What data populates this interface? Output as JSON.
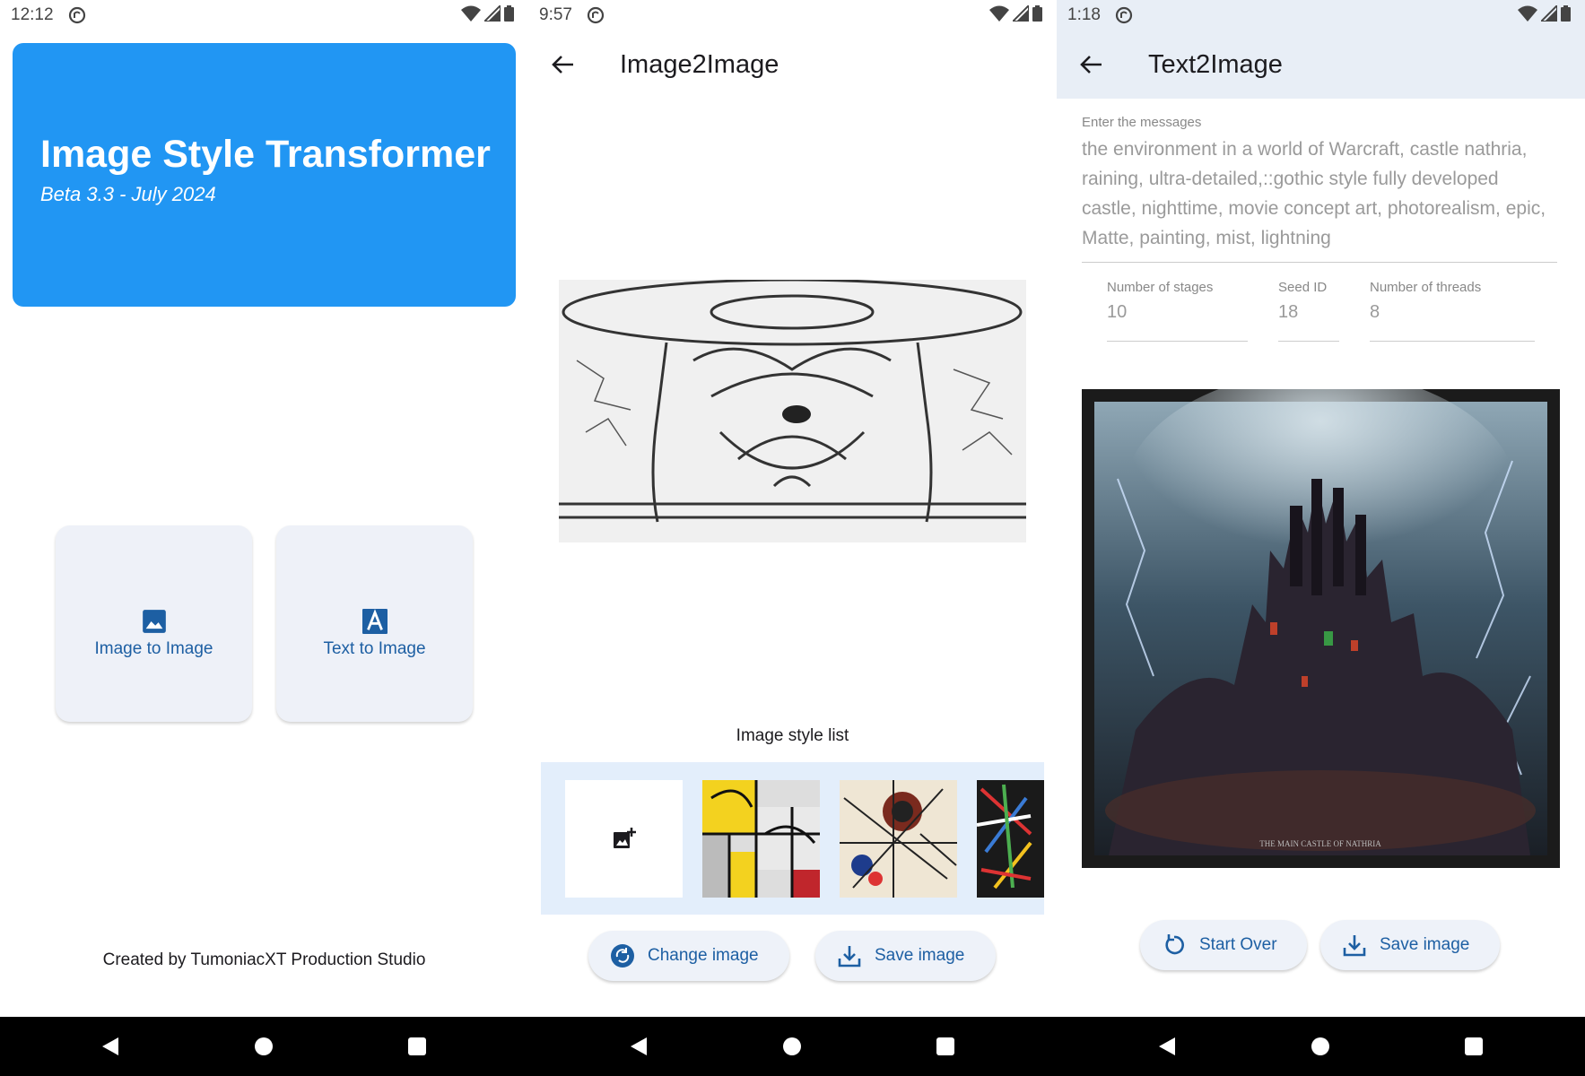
{
  "screen1": {
    "status_time": "12:12",
    "hero_title": "Image Style Transformer",
    "hero_subtitle": "Beta 3.3 - July 2024",
    "card_image_to_image": "Image to Image",
    "card_text_to_image": "Text to Image",
    "credit": "Created by TumoniacXT Production Studio",
    "colors": {
      "hero": "#2196f3",
      "accent": "#1d5fa3"
    },
    "icons": [
      "image-icon",
      "text-a-icon"
    ]
  },
  "screen2": {
    "status_time": "9:57",
    "title": "Image2Image",
    "style_list_label": "Image style list",
    "change_image_label": "Change image",
    "save_image_label": "Save image",
    "icons": [
      "back-arrow-icon",
      "add-photo-icon",
      "sync-icon",
      "download-icon"
    ]
  },
  "screen3": {
    "status_time": "1:18",
    "title": "Text2Image",
    "messages_label": "Enter the messages",
    "messages_text": "the environment in a world of Warcraft, castle nathria, raining, ultra-detailed,::gothic style fully developed castle, nighttime, movie concept art, photorealism, epic, Matte, painting, mist, lightning",
    "stages_label": "Number of stages",
    "stages_value": "10",
    "seed_label": "Seed ID",
    "seed_value": "18",
    "threads_label": "Number of threads",
    "threads_value": "8",
    "image_caption": "THE MAIN CASTLE OF NATHRIA",
    "start_over_label": "Start Over",
    "save_image_label": "Save image",
    "icons": [
      "back-arrow-icon",
      "restart-icon",
      "download-icon"
    ]
  },
  "navigation": {
    "icons": [
      "back-triangle-icon",
      "home-circle-icon",
      "recents-square-icon"
    ]
  }
}
